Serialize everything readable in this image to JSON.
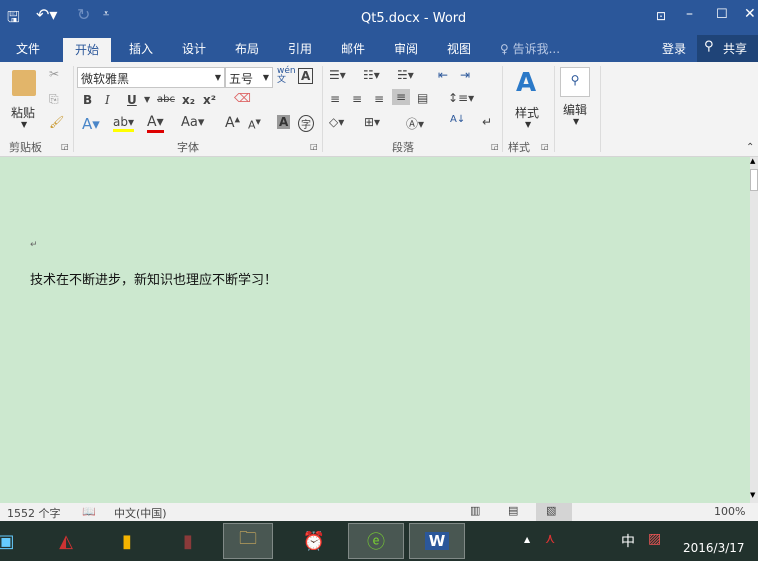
{
  "titlebar": {
    "title": "Qt5.docx - Word",
    "save_icon": "save-icon",
    "undo_icon": "undo-icon",
    "redo_icon": "redo-icon",
    "customize_icon": "customize-qat-icon"
  },
  "tabs": [
    {
      "label": "文件"
    },
    {
      "label": "开始"
    },
    {
      "label": "插入"
    },
    {
      "label": "设计"
    },
    {
      "label": "布局"
    },
    {
      "label": "引用"
    },
    {
      "label": "邮件"
    },
    {
      "label": "审阅"
    },
    {
      "label": "视图"
    }
  ],
  "tell_me": "告诉我...",
  "login": "登录",
  "share": "共享",
  "ribbon": {
    "paste": "粘贴",
    "clipboard": "剪贴板",
    "font_name": "微软雅黑",
    "font_size": "五号",
    "phonetic": "wén\n文",
    "font_group": "字体",
    "paragraph_group": "段落",
    "styles_button": "样式",
    "styles_group": "样式",
    "edit_button": "编辑",
    "bold": "B",
    "italic": "I",
    "underline": "U",
    "strike": "abc",
    "sub": "x₂",
    "sup": "x²",
    "changecase": "Aa",
    "grow": "A",
    "shrink": "A"
  },
  "document": {
    "paragraph_mark": "↵",
    "text": "技术在不断进步，新知识也理应不断学习！"
  },
  "status": {
    "word_count": "1552 个字",
    "language": "中文(中国)",
    "zoom": "100%"
  },
  "taskbar": {
    "ime": "中",
    "date": "2016/3/17"
  },
  "colors": {
    "accent": "#2b579a",
    "doc_bg": "#cce8cf"
  }
}
